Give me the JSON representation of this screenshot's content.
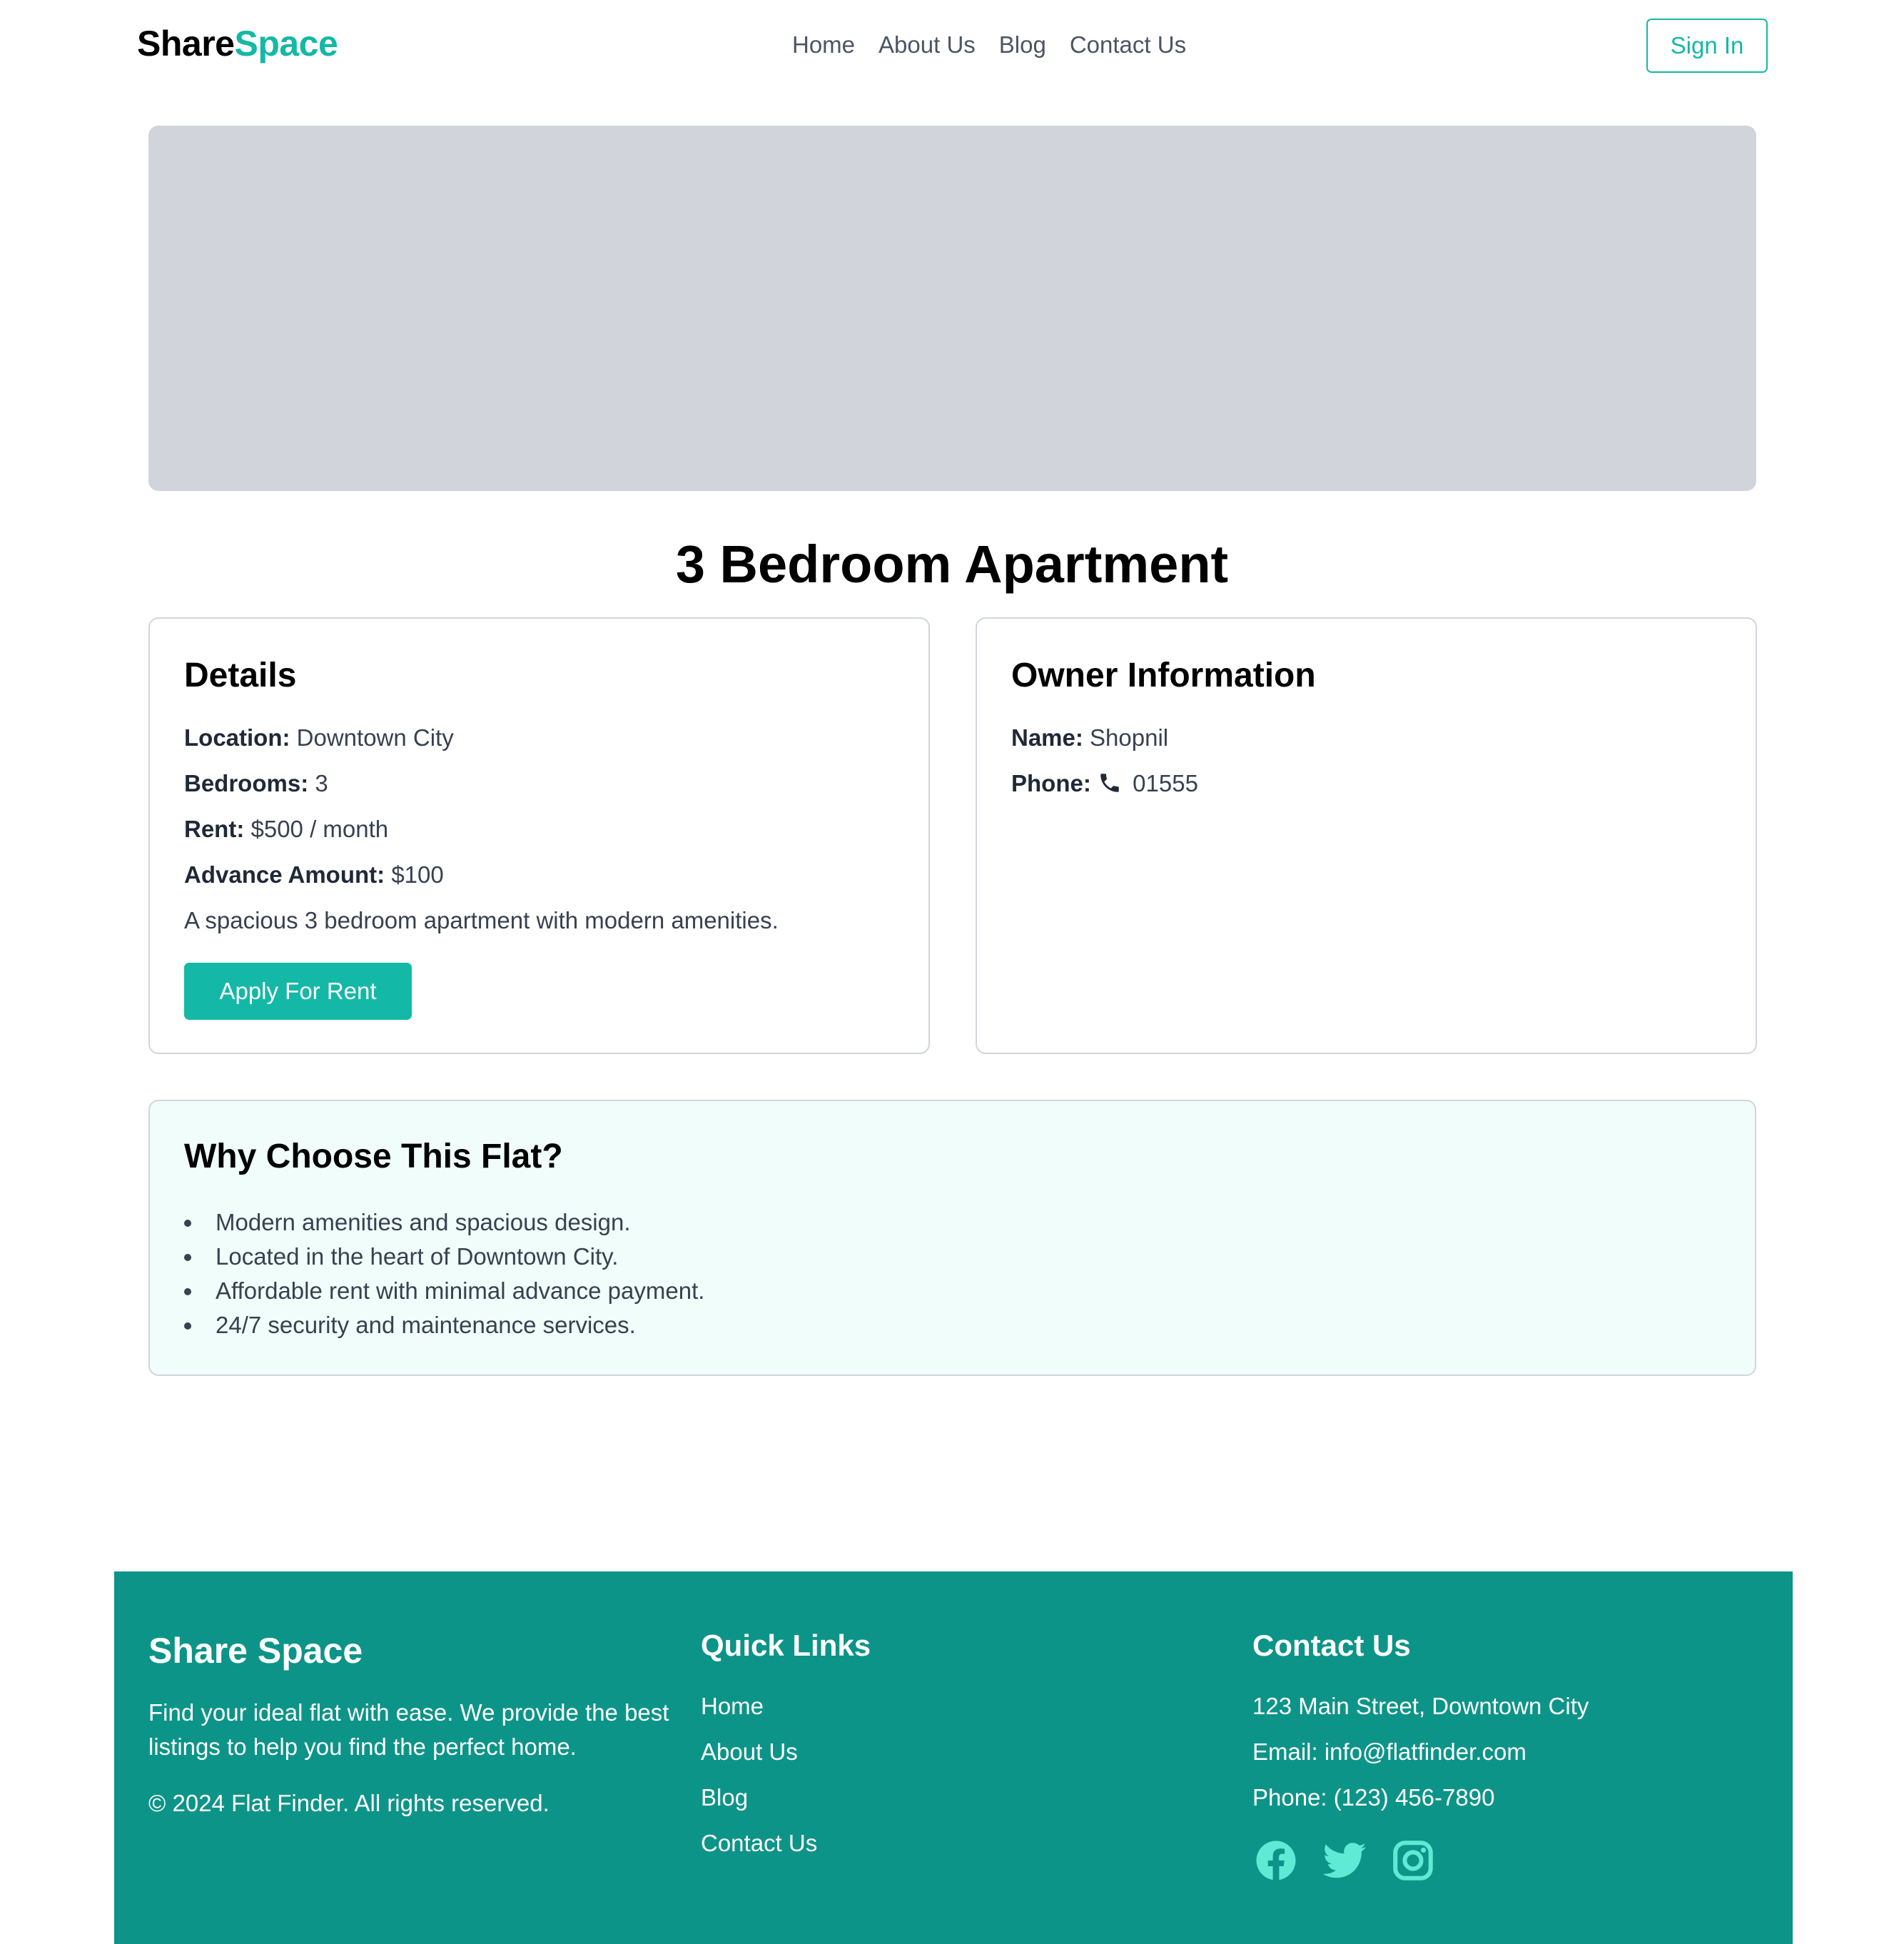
{
  "navbar": {
    "brand_part1": "Share",
    "brand_part2": "Space",
    "links": [
      "Home",
      "About Us",
      "Blog",
      "Contact Us"
    ],
    "signin_label": "Sign In"
  },
  "listing": {
    "title": "3 Bedroom Apartment"
  },
  "details": {
    "heading": "Details",
    "location_label": "Location:",
    "location_value": "Downtown City",
    "bedrooms_label": "Bedrooms:",
    "bedrooms_value": "3",
    "rent_label": "Rent:",
    "rent_value": "$500 / month",
    "advance_label": "Advance Amount:",
    "advance_value": "$100",
    "description": "A spacious 3 bedroom apartment with modern amenities.",
    "apply_label": "Apply For Rent"
  },
  "owner": {
    "heading": "Owner Information",
    "name_label": "Name:",
    "name_value": "Shopnil",
    "phone_label": "Phone:",
    "phone_value": "01555",
    "phone_icon": "phone-icon"
  },
  "why": {
    "heading": "Why Choose This Flat?",
    "items": [
      "Modern amenities and spacious design.",
      "Located in the heart of Downtown City.",
      "Affordable rent with minimal advance payment.",
      "24/7 security and maintenance services."
    ]
  },
  "footer": {
    "brand": "Share Space",
    "description": "Find your ideal flat with ease. We provide the best listings to help you find the perfect home.",
    "copyright": "© 2024 Flat Finder. All rights reserved.",
    "quick_links_heading": "Quick Links",
    "quick_links": [
      "Home",
      "About Us",
      "Blog",
      "Contact Us"
    ],
    "contact_heading": "Contact Us",
    "address": "123 Main Street, Downtown City",
    "email": "Email: info@flatfinder.com",
    "phone": "Phone: (123) 456-7890",
    "social_icons": [
      "facebook-icon",
      "twitter-icon",
      "instagram-icon"
    ]
  },
  "colors": {
    "accent": "#14b8a6",
    "footer_bg": "#0d9488",
    "social_icon": "#5eead4",
    "hero_placeholder": "#d1d5db",
    "why_bg": "#f0fdfa"
  }
}
